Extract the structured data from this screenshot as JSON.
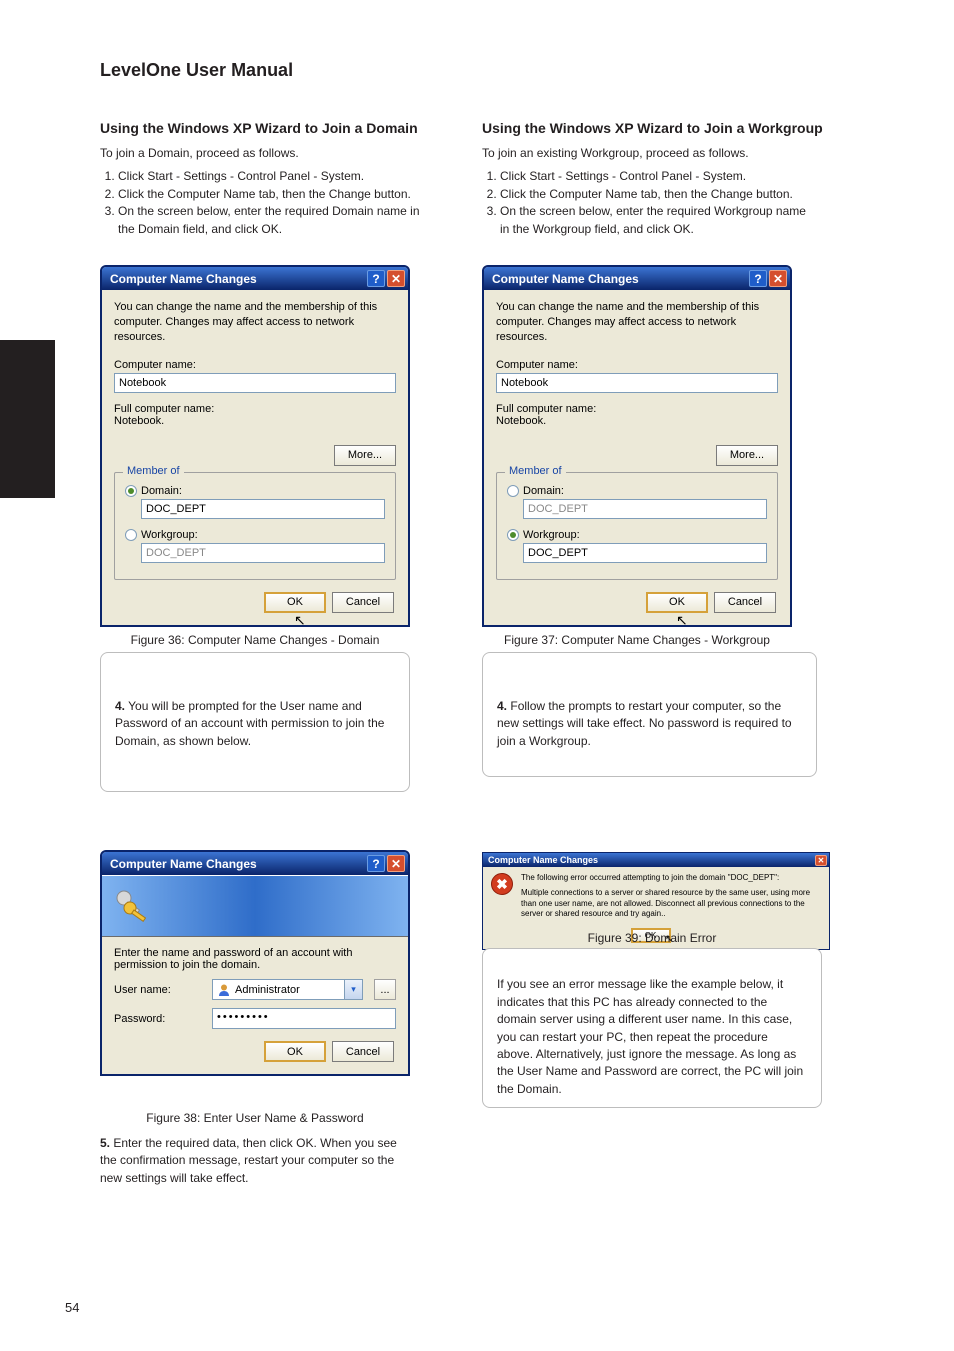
{
  "page": {
    "header": "LevelOne User Manual",
    "page_number_top": "54",
    "page_number_bottom": "54",
    "sectionA_title": "Using the Windows XP Wizard to Join a Domain",
    "sectionA_intro": "To join a Domain, proceed as follows.",
    "stepsA": [
      "Click Start - Settings - Control Panel - System.",
      "Click the Computer Name tab, then the Change button.",
      "On the screen below, enter the required Domain name in the Domain field, and click OK."
    ],
    "sectionB_title": "Using the Windows XP Wizard to Join a Workgroup",
    "sectionB_intro": "To join an existing Workgroup, proceed as follows.",
    "stepsB": [
      "Click Start - Settings - Control Panel - System.",
      "Click the Computer Name tab, then the Change button.",
      "On the screen below, enter the required Workgroup name in the Workgroup field, and click OK."
    ],
    "figureA_caption": "Figure 36: Computer Name Changes - Domain",
    "figureB_caption": "Figure 37: Computer Name Changes - Workgroup",
    "noteA": {
      "num": "4.",
      "text": "You will be prompted for the User name and Password of an account with permission to join the Domain, as shown below."
    },
    "noteB": {
      "num": "4.",
      "text": "Follow the prompts to restart your computer, so the new settings will take effect. No password is required to join a Workgroup."
    },
    "figureC_caption": "Figure 38: Enter User Name & Password",
    "stepC": {
      "num": "5.",
      "text": "Enter the required data, then click OK. When you see the confirmation message, restart your computer so the new settings will take effect."
    },
    "errorNote": "If you see an error message like the example below, it indicates that this PC has already connected to the domain server using a different user name. In this case, you can restart your PC, then repeat the procedure above. Alternatively, just ignore the message. As long as the User Name and Password are correct, the PC will join the Domain.",
    "figureD_caption": "Figure 39: Domain Error"
  },
  "dlgA": {
    "title": "Computer Name Changes",
    "desc": "You can change the name and the membership of this computer. Changes may affect access to network resources.",
    "computerNameLabel": "Computer name:",
    "computerNameValue": "Notebook",
    "fullNameLabel": "Full computer name:",
    "fullNameValue": "Notebook.",
    "moreBtn": "More...",
    "memberOf": "Member of",
    "domainLabel": "Domain:",
    "domainValue": "DOC_DEPT",
    "workgroupLabel": "Workgroup:",
    "workgroupValue": "DOC_DEPT",
    "ok": "OK",
    "cancel": "Cancel"
  },
  "dlgB": {
    "title": "Computer Name Changes",
    "desc": "You can change the name and the membership of this computer. Changes may affect access to network resources.",
    "computerNameLabel": "Computer name:",
    "computerNameValue": "Notebook",
    "fullNameLabel": "Full computer name:",
    "fullNameValue": "Notebook.",
    "moreBtn": "More...",
    "memberOf": "Member of",
    "domainLabel": "Domain:",
    "domainValue": "DOC_DEPT",
    "workgroupLabel": "Workgroup:",
    "workgroupValue": "DOC_DEPT",
    "ok": "OK",
    "cancel": "Cancel"
  },
  "dlgCred": {
    "title": "Computer Name Changes",
    "prompt": "Enter the name and password of an account with permission to join the domain.",
    "userLabel": "User name:",
    "userValue": "Administrator",
    "pwdLabel": "Password:",
    "pwdValue": "•••••••••",
    "ok": "OK",
    "cancel": "Cancel",
    "browse": "..."
  },
  "dlgErr": {
    "title": "Computer Name Changes",
    "line1": "The following error occurred attempting to join the domain \"DOC_DEPT\":",
    "line2": "Multiple connections to a server or shared resource by the same user, using more than one user name, are not allowed. Disconnect all previous connections to the server or shared resource and try again..",
    "ok": "OK"
  }
}
